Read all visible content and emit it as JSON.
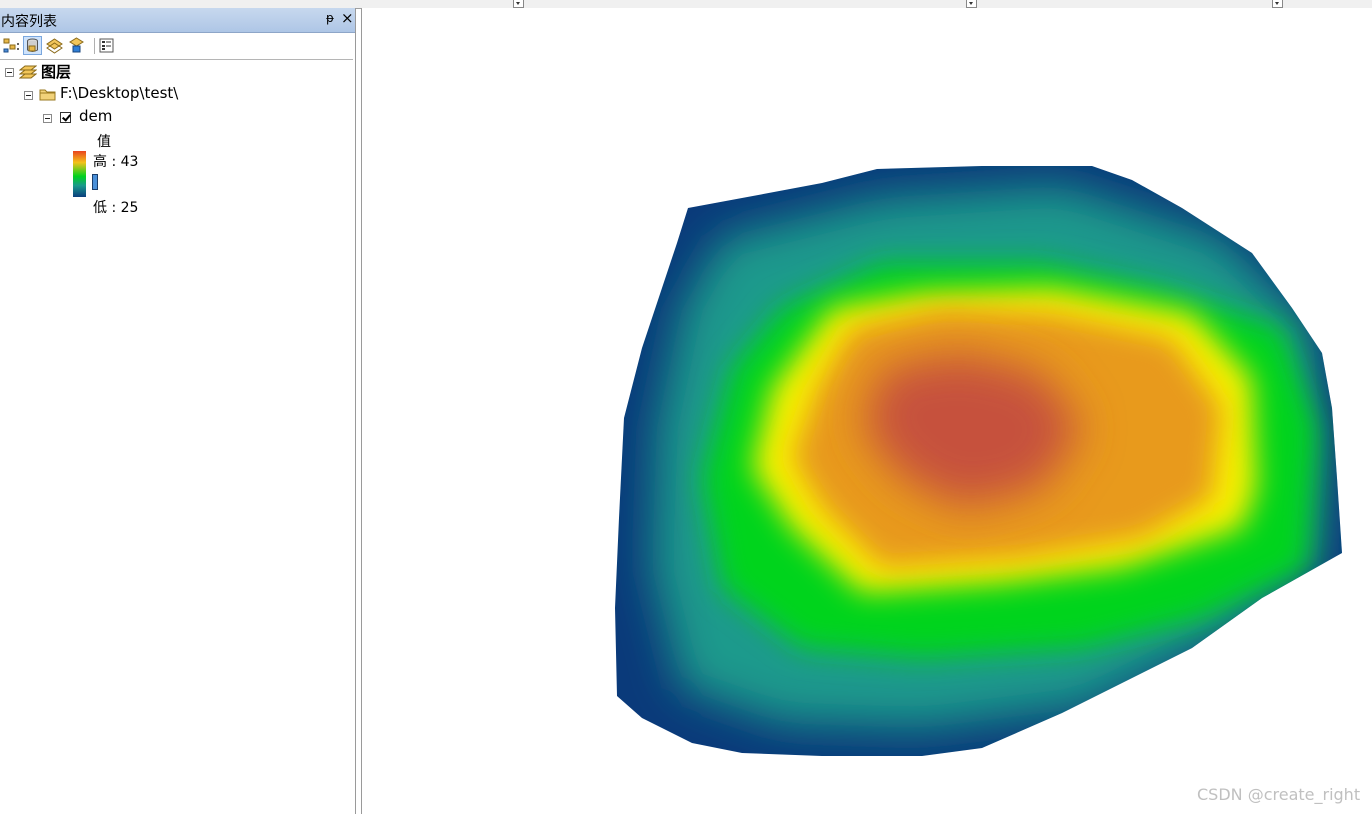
{
  "toc": {
    "title": "内容列表",
    "pin_glyph": "ᵽ",
    "close_glyph": "×",
    "toolbar": [
      {
        "name": "list-by-drawing-order-icon"
      },
      {
        "name": "list-by-source-icon"
      },
      {
        "name": "list-by-visibility-icon"
      },
      {
        "name": "list-by-selection-icon"
      },
      {
        "name": "options-icon"
      }
    ],
    "layers_label": "图层",
    "folder_label": "F:\\Desktop\\test\\",
    "layer_name": "dem",
    "legend": {
      "field_label": "值",
      "high_label": "高 : 43",
      "low_label": "低 : 25",
      "ramp_colors": [
        "#e8451f",
        "#f4c21a",
        "#00d21e",
        "#1a9a8c",
        "#0b3e7e"
      ]
    }
  },
  "map": {
    "colors": {
      "peak": "#c6513d",
      "orange": "#e89a1a",
      "yellow": "#f8f000",
      "green": "#00d41c",
      "teal": "#1f9a8c",
      "blue": "#0a3a7a"
    }
  },
  "watermark": "CSDN @create_right"
}
